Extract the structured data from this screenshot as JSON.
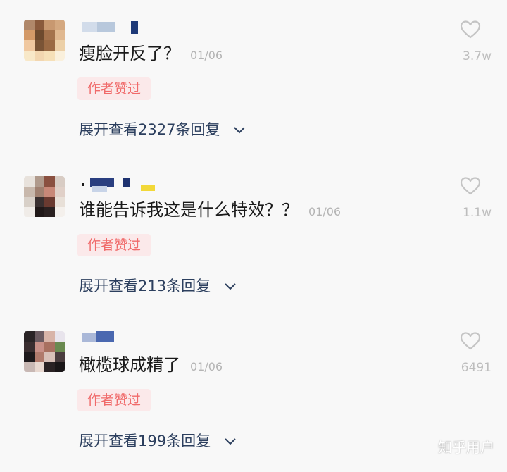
{
  "comments": [
    {
      "text": "瘦脸开反了？",
      "date": "01/06",
      "likes": "3.7w",
      "badge": "作者赞过",
      "expand_label": "展开查看2327条回复"
    },
    {
      "text": "谁能告诉我这是什么特效？？",
      "date": "01/06",
      "likes": "1.1w",
      "badge": "作者赞过",
      "expand_label": "展开查看213条回复"
    },
    {
      "text": "橄榄球成精了",
      "date": "01/06",
      "likes": "6491",
      "badge": "作者赞过",
      "expand_label": "展开查看199条回复"
    }
  ],
  "watermark": "知乎用户",
  "icons": {
    "like": "heart-icon",
    "expand": "chevron-down-icon"
  },
  "colors": {
    "badge_bg": "#fbe9ea",
    "badge_text": "#f06a6a",
    "link": "#2c3f5e",
    "muted": "#b4b4b4"
  }
}
